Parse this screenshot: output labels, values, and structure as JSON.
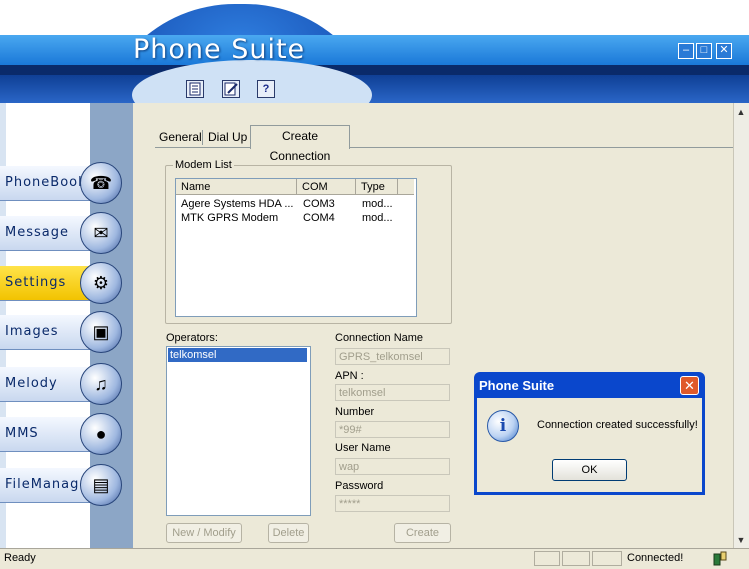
{
  "app": {
    "title": "Phone Suite"
  },
  "window_controls": {
    "minimize": "–",
    "maximize": "□",
    "close": "✕"
  },
  "toolbar": {
    "icons": [
      "document-icon",
      "edit-icon",
      "help-icon"
    ],
    "help_glyph": "?"
  },
  "sidebar": {
    "items": [
      {
        "label": "PhoneBook",
        "icon": "phone-icon",
        "glyph": "☎",
        "active": false
      },
      {
        "label": "Message",
        "icon": "envelope-icon",
        "glyph": "✉",
        "active": false
      },
      {
        "label": "Settings",
        "icon": "settings-icon",
        "glyph": "⚙",
        "active": true
      },
      {
        "label": "Images",
        "icon": "image-icon",
        "glyph": "▣",
        "active": false
      },
      {
        "label": "Melody",
        "icon": "saxophone-icon",
        "glyph": "♫",
        "active": false
      },
      {
        "label": "MMS",
        "icon": "balloon-icon",
        "glyph": "●",
        "active": false
      },
      {
        "label": "FileManager",
        "icon": "folder-icon",
        "glyph": "▤",
        "active": false
      }
    ]
  },
  "tabs": {
    "general": "General",
    "dialup": "Dial Up",
    "create": "Create Connection",
    "active": "create"
  },
  "modem_list": {
    "legend": "Modem List",
    "columns": [
      "Name",
      "COM",
      "Type"
    ],
    "rows": [
      [
        "Agere Systems HDA ...",
        "COM3",
        "mod..."
      ],
      [
        "MTK GPRS Modem",
        "COM4",
        "mod..."
      ]
    ]
  },
  "operators": {
    "label": "Operators:",
    "items": [
      "telkomsel"
    ],
    "selected": "telkomsel"
  },
  "form": {
    "connection_name_label": "Connection Name",
    "connection_name": "GPRS_telkomsel",
    "apn_label": "APN :",
    "apn": "telkomsel",
    "number_label": "Number",
    "number": "*99#",
    "username_label": "User Name",
    "username": "wap",
    "password_label": "Password",
    "password": "*****"
  },
  "buttons": {
    "new_modify": "New / Modify",
    "delete": "Delete",
    "create": "Create"
  },
  "dialog": {
    "title": "Phone Suite",
    "message": "Connection created successfully!",
    "ok": "OK",
    "icon": "info-icon",
    "icon_glyph": "i",
    "close_glyph": "✕"
  },
  "status": {
    "left": "Ready",
    "right": "Connected!"
  },
  "scrollbar": {
    "up": "▲",
    "down": "▼"
  }
}
